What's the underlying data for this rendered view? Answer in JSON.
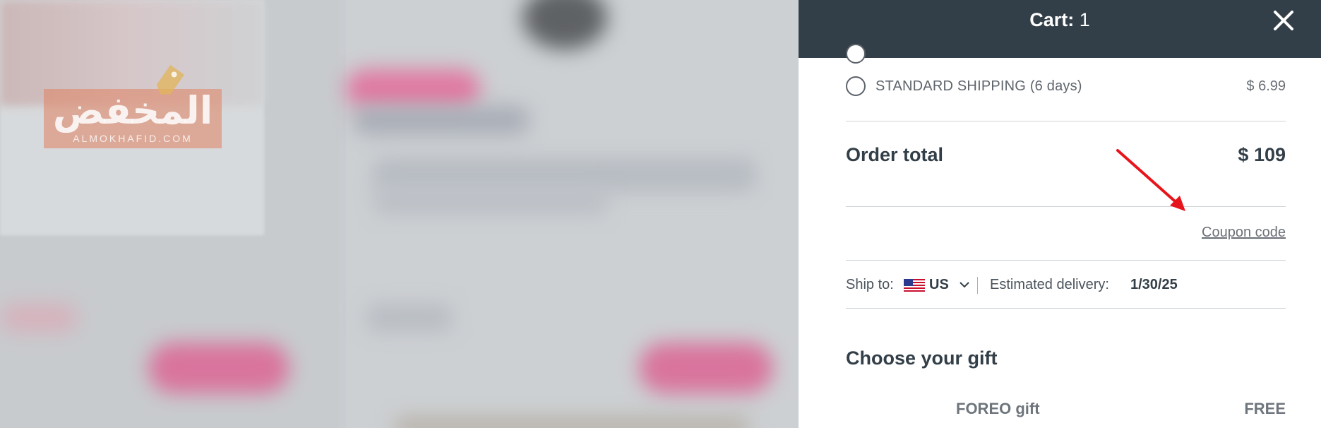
{
  "background": {
    "logo": {
      "arabic_text": "المخفض",
      "latin_text": "ALMOKHAFID.COM"
    }
  },
  "cart": {
    "title_label": "Cart:",
    "count": "1",
    "close_icon": "close-icon"
  },
  "shipping": {
    "option_label": "STANDARD SHIPPING (6 days)",
    "option_price": "$ 6.99"
  },
  "order": {
    "total_label": "Order total",
    "total_value": "$ 109"
  },
  "coupon": {
    "label": "Coupon code"
  },
  "delivery": {
    "ship_to_label": "Ship to:",
    "country": "US",
    "flag_icon": "us-flag-icon",
    "estimated_label": "Estimated delivery:",
    "estimated_date": "1/30/25"
  },
  "gift": {
    "section_title": "Choose your gift",
    "item_name": "FOREO gift",
    "item_price": "FREE"
  },
  "colors": {
    "header_bg": "#333f48",
    "text_dark": "#333f48",
    "annotation_arrow": "#e8141c"
  }
}
